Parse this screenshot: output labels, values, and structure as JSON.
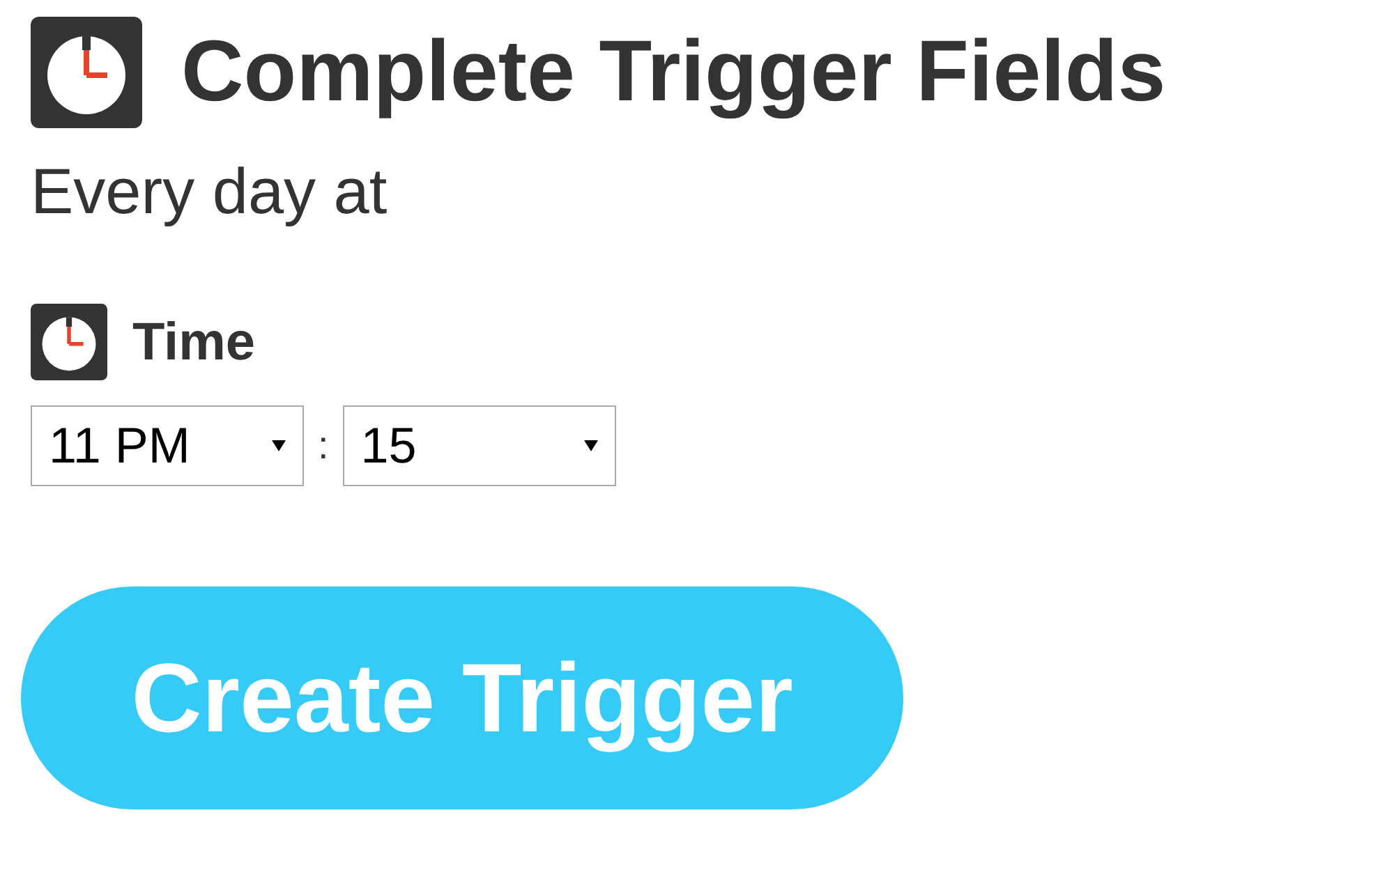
{
  "title": "Complete Trigger Fields",
  "subtitle": "Every day at",
  "field": {
    "label": "Time",
    "hour": "11 PM",
    "separator": ":",
    "minute": "15"
  },
  "button": "Create Trigger"
}
